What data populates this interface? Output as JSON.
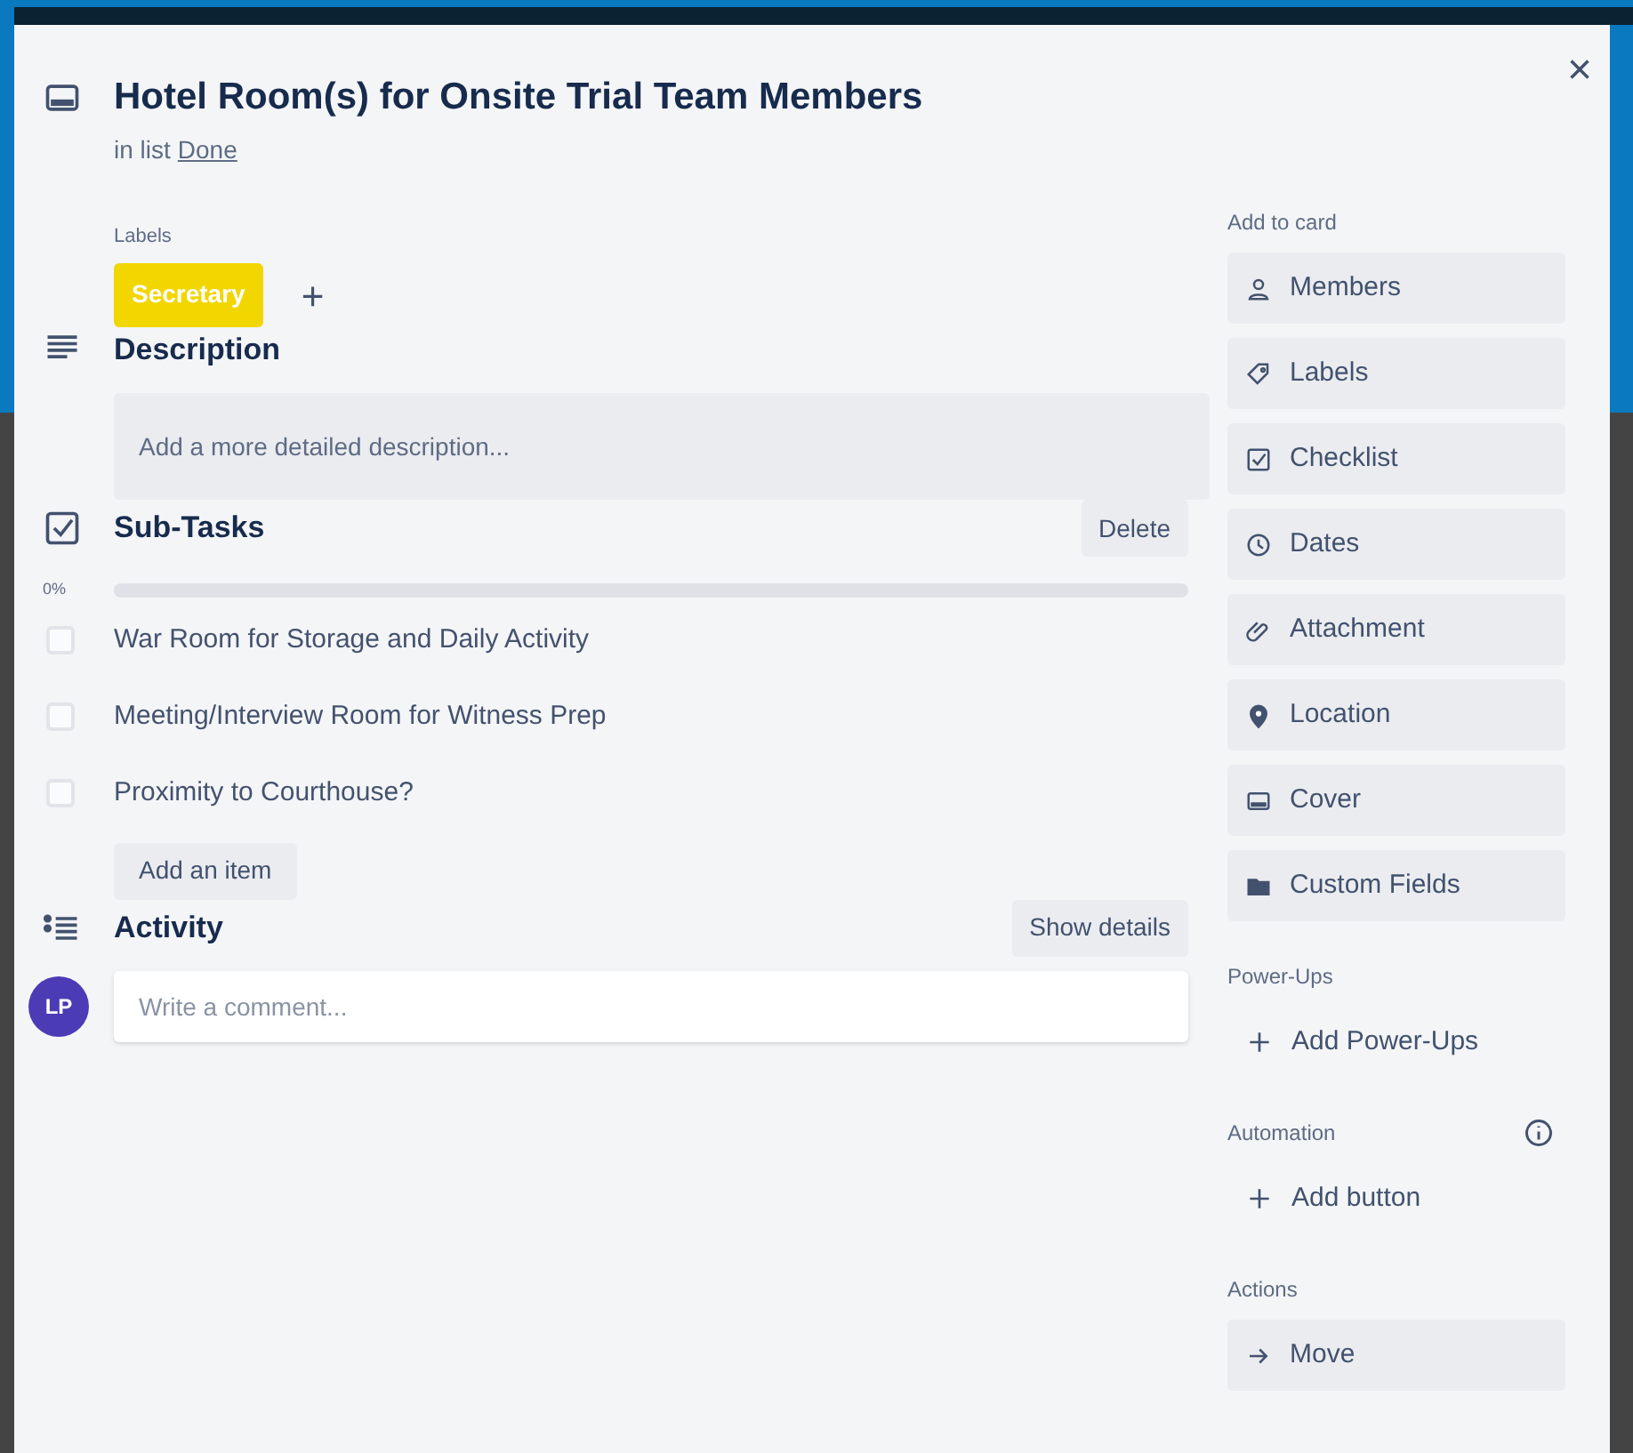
{
  "card": {
    "title": "Hotel Room(s) for Onsite Trial Team Members",
    "list_prefix": "in list",
    "list_name": "Done"
  },
  "labels": {
    "heading": "Labels",
    "items": [
      {
        "text": "Secretary",
        "color": "#f2d600"
      }
    ],
    "add": "+"
  },
  "description": {
    "heading": "Description",
    "placeholder": "Add a more detailed description..."
  },
  "checklist": {
    "heading": "Sub-Tasks",
    "delete": "Delete",
    "percent": "0%",
    "level": 0,
    "items": [
      {
        "text": "War Room for Storage and Daily Activity",
        "checked": false
      },
      {
        "text": "Meeting/Interview Room for Witness Prep",
        "checked": false
      },
      {
        "text": "Proximity to Courthouse?",
        "checked": false
      }
    ],
    "add_item": "Add an item"
  },
  "activity": {
    "heading": "Activity",
    "show_details": "Show details",
    "avatar": "LP",
    "placeholder": "Write a comment..."
  },
  "sidebar": [
    {
      "title": "Add to card",
      "info": false,
      "items": [
        {
          "label": "Members"
        },
        {
          "label": "Labels"
        },
        {
          "label": "Checklist"
        },
        {
          "label": "Dates"
        },
        {
          "label": "Attachment"
        },
        {
          "label": "Location"
        },
        {
          "label": "Cover"
        },
        {
          "label": "Custom Fields"
        }
      ]
    },
    {
      "title": "Power-Ups",
      "info": false,
      "items": [
        {
          "label": "Add Power-Ups",
          "kind": "plain"
        }
      ]
    },
    {
      "title": "Automation",
      "info": true,
      "items": [
        {
          "label": "Add button",
          "kind": "plain"
        }
      ]
    },
    {
      "title": "Actions",
      "info": false,
      "items": [
        {
          "label": "Move"
        }
      ]
    }
  ],
  "close": "×"
}
